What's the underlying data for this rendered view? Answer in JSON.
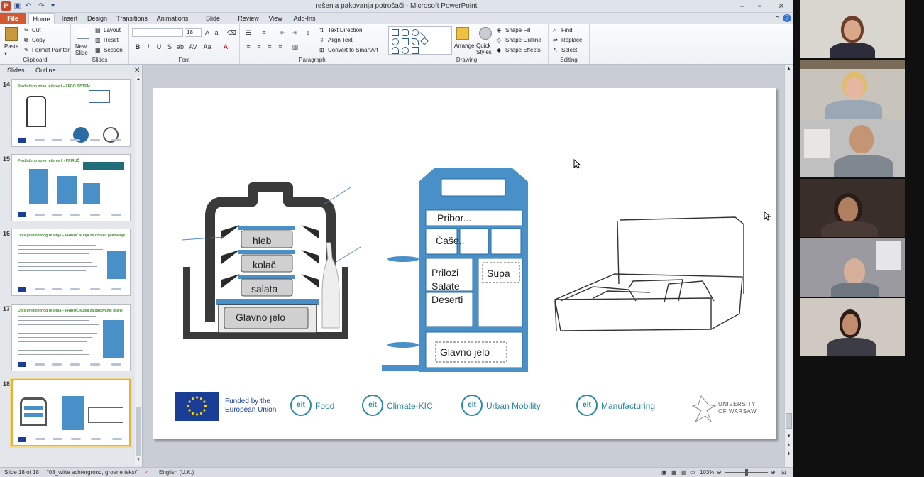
{
  "window": {
    "title": "rešenja pakovanja potrošači  -  Microsoft PowerPoint"
  },
  "tabs": [
    "File",
    "Home",
    "Insert",
    "Design",
    "Transitions",
    "Animations",
    "Slide Show",
    "Review",
    "View",
    "Add-Ins"
  ],
  "ribbon": {
    "clipboard": {
      "label": "Clipboard",
      "paste": "Paste",
      "cut": "Cut",
      "copy": "Copy",
      "format_painter": "Format Painter"
    },
    "slides": {
      "label": "Slides",
      "new_slide": "New Slide",
      "layout": "Layout",
      "reset": "Reset",
      "section": "Section"
    },
    "font": {
      "label": "Font",
      "size": "18"
    },
    "paragraph": {
      "label": "Paragraph",
      "text_direction": "Text Direction",
      "align_text": "Align Text",
      "convert_smartart": "Convert to SmartArt"
    },
    "drawing": {
      "label": "Drawing",
      "arrange": "Arrange",
      "quick_styles": "Quick Styles",
      "shape_fill": "Shape Fill",
      "shape_outline": "Shape Outline",
      "shape_effects": "Shape Effects"
    },
    "editing": {
      "label": "Editing",
      "find": "Find",
      "replace": "Replace",
      "select": "Select"
    }
  },
  "panel": {
    "tabs": [
      "Slides",
      "Outline"
    ],
    "thumbs": [
      {
        "num": "14",
        "title": "Predloženo novo rešenje I – LEGO SISTEM"
      },
      {
        "num": "15",
        "title": "Predloženo novo rešenje II - PRIRUČ"
      },
      {
        "num": "16",
        "title": "Opis predloženog rešenja – PRIRUČ kutija za zimsko pakovanje"
      },
      {
        "num": "17",
        "title": "Opis predloženog rešenja – PRIRUČ kutija za pakovanje hrane"
      },
      {
        "num": "18",
        "title": ""
      }
    ]
  },
  "slide": {
    "container1": {
      "items": [
        "hleb",
        "kolač",
        "salata",
        "Glavno jelo"
      ]
    },
    "container2": {
      "items": [
        "Pribor...",
        "Čaše..",
        "Prilozi\nSalate",
        "Deserti",
        "Supa",
        "Glavno jelo"
      ]
    },
    "footer": {
      "eu_text": "Funded by the\nEuropean Union",
      "eit": [
        {
          "badge": "eit",
          "name": "Food"
        },
        {
          "badge": "eit",
          "name": "Climate-KIC"
        },
        {
          "badge": "eit",
          "name": "Urban Mobility"
        },
        {
          "badge": "eit",
          "name": "Manufacturing"
        }
      ],
      "university": "UNIVERSITY\nOF WARSAW"
    }
  },
  "status": {
    "slide": "Slide 18 of 18",
    "theme": "\"08_witte achtergrond, groene tekst\"",
    "language": "English (U.K.)",
    "zoom": "103%"
  },
  "colors": {
    "accent": "#4a90c8",
    "dark": "#2a6ba3",
    "file_tab": "#d35a30",
    "thumb_selected": "#e4b33f"
  }
}
